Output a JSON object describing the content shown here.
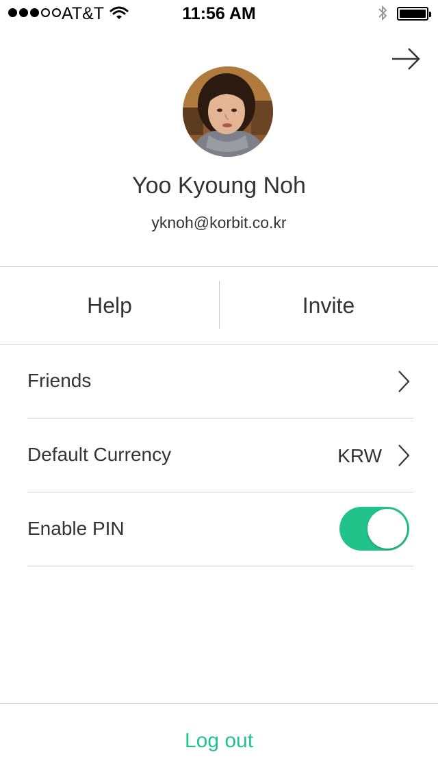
{
  "status_bar": {
    "carrier": "AT&T",
    "time": "11:56 AM",
    "signal_bars_filled": 3,
    "signal_bars_total": 5,
    "battery_level": 1.0
  },
  "header": {
    "forward_icon": "arrow-right-icon"
  },
  "profile": {
    "name": "Yoo Kyoung Noh",
    "email": "yknoh@korbit.co.kr"
  },
  "actions": {
    "help_label": "Help",
    "invite_label": "Invite"
  },
  "settings": {
    "friends_label": "Friends",
    "currency_label": "Default Currency",
    "currency_value": "KRW",
    "pin_label": "Enable PIN",
    "pin_enabled": true
  },
  "footer": {
    "logout_label": "Log out"
  },
  "colors": {
    "accent": "#22c38a",
    "text": "#333333",
    "divider": "#c8c8c8"
  }
}
